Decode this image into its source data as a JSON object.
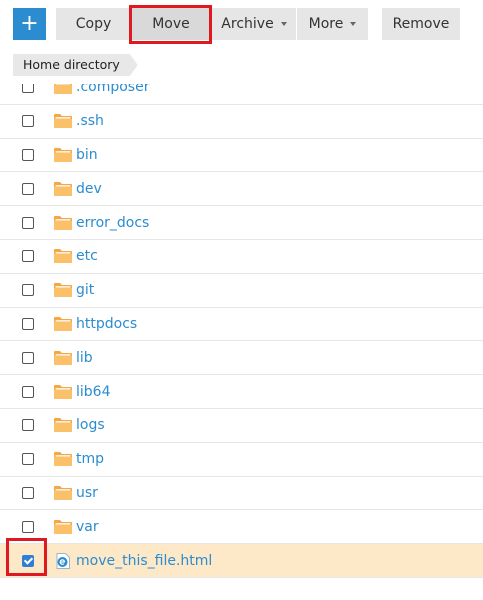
{
  "toolbar": {
    "add_label": "+",
    "copy_label": "Copy",
    "move_label": "Move",
    "archive_label": "Archive",
    "more_label": "More",
    "remove_label": "Remove"
  },
  "breadcrumb": {
    "label": "Home directory"
  },
  "files": [
    {
      "name": ".composer",
      "type": "folder",
      "checked": false
    },
    {
      "name": ".ssh",
      "type": "folder",
      "checked": false
    },
    {
      "name": "bin",
      "type": "folder",
      "checked": false
    },
    {
      "name": "dev",
      "type": "folder",
      "checked": false
    },
    {
      "name": "error_docs",
      "type": "folder",
      "checked": false
    },
    {
      "name": "etc",
      "type": "folder",
      "checked": false
    },
    {
      "name": "git",
      "type": "folder",
      "checked": false
    },
    {
      "name": "httpdocs",
      "type": "folder",
      "checked": false
    },
    {
      "name": "lib",
      "type": "folder",
      "checked": false
    },
    {
      "name": "lib64",
      "type": "folder",
      "checked": false
    },
    {
      "name": "logs",
      "type": "folder",
      "checked": false
    },
    {
      "name": "tmp",
      "type": "folder",
      "checked": false
    },
    {
      "name": "usr",
      "type": "folder",
      "checked": false
    },
    {
      "name": "var",
      "type": "folder",
      "checked": false
    },
    {
      "name": "move_this_file.html",
      "type": "html",
      "checked": true
    }
  ],
  "colors": {
    "accent": "#2b8ccf",
    "selected_row": "#fde8c8",
    "highlight": "#e0181f",
    "folder": "#f5a742"
  }
}
